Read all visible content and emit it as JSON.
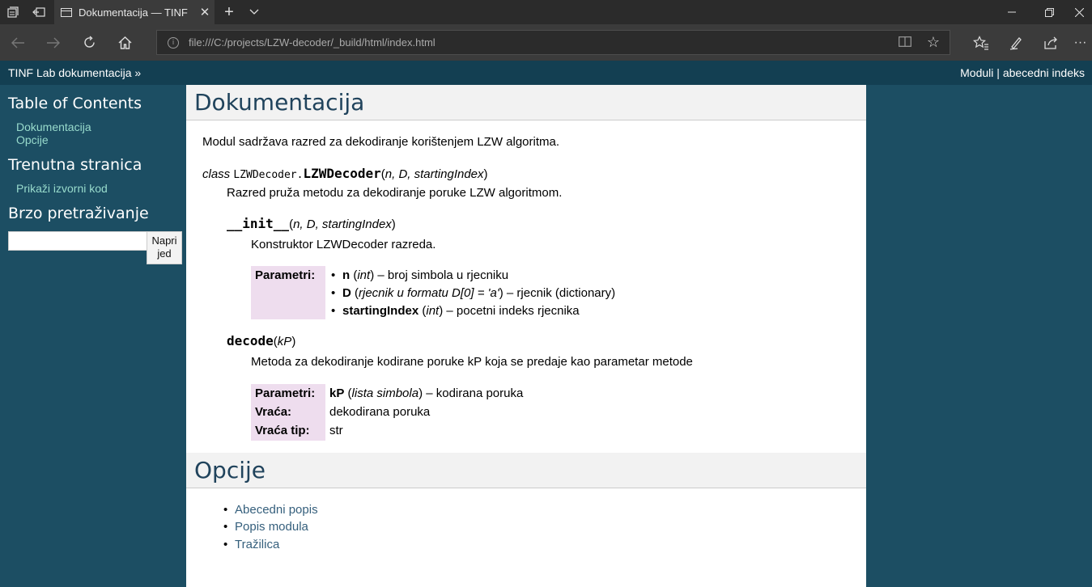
{
  "browser": {
    "tab_title": "Dokumentacija — TINF",
    "url": "file:///C:/projects/LZW-decoder/_build/html/index.html",
    "icons": [
      "tab-preview-icon",
      "set-aside-tabs-icon",
      "page-icon",
      "close-icon",
      "new-tab-icon",
      "chevron-down-icon",
      "minimize-icon",
      "restore-icon",
      "window-close-icon",
      "back-icon",
      "forward-icon",
      "refresh-icon",
      "home-icon",
      "info-icon",
      "reading-view-icon",
      "star-icon",
      "favorites-icon",
      "pen-icon",
      "share-icon",
      "more-icon"
    ]
  },
  "related": {
    "home": "TINF Lab dokumentacija",
    "home_sep": "»",
    "modules": "Moduli",
    "sep": "|",
    "index": "abecedni indeks"
  },
  "sidebar": {
    "toc_title": "Table of Contents",
    "toc_items": [
      "Dokumentacija",
      "Opcije"
    ],
    "current_title": "Trenutna stranica",
    "show_source": "Prikaži izvorni kod",
    "search_title": "Brzo pretraživanje",
    "search_value": "",
    "search_button_line1": "Napri",
    "search_button_line2": "jed"
  },
  "doc": {
    "title": "Dokumentacija",
    "intro": "Modul sadržava razred za dekodiranje korištenjem LZW algoritma.",
    "class_kw": "class",
    "class_module": "LZWDecoder.",
    "class_name": "LZWDecoder",
    "class_args": "n, D, startingIndex",
    "class_desc": "Razred pruža metodu za dekodiranje poruke LZW algoritmom.",
    "init_name": "__init__",
    "init_args": "n, D, startingIndex",
    "init_desc": "Konstruktor LZWDecoder razreda.",
    "init_params_label": "Parametri:",
    "init_params": [
      {
        "name": "n",
        "type": "int",
        "desc": "– broj simbola u rjecniku"
      },
      {
        "name": "D",
        "type": "rjecnik u formatu D[0] = 'a'",
        "desc": "– rjecnik (dictionary)"
      },
      {
        "name": "startingIndex",
        "type": "int",
        "desc": "– pocetni indeks rjecnika"
      }
    ],
    "decode_name": "decode",
    "decode_args": "kP",
    "decode_desc": "Metoda za dekodiranje kodirane poruke kP koja se predaje kao parametar metode",
    "decode_params_label": "Parametri:",
    "decode_param_name": "kP",
    "decode_param_type": "lista simbola",
    "decode_param_desc": "– kodirana poruka",
    "returns_label": "Vraća:",
    "returns_value": "dekodirana poruka",
    "rtype_label": "Vraća tip:",
    "rtype_value": "str"
  },
  "options": {
    "title": "Opcije",
    "links": [
      "Abecedni popis",
      "Popis modula",
      "Tražilica"
    ]
  }
}
